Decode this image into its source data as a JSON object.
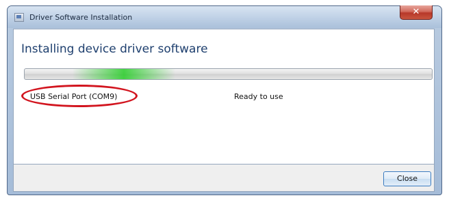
{
  "window": {
    "title": "Driver Software Installation",
    "close_glyph": "✕"
  },
  "main": {
    "heading": "Installing device driver software",
    "device": {
      "name": "USB Serial Port (COM9)",
      "status": "Ready to use"
    },
    "progress": {
      "state": "indeterminate"
    },
    "annotation": {
      "shape": "ellipse",
      "color": "#d2141e"
    }
  },
  "footer": {
    "close_label": "Close"
  },
  "colors": {
    "heading": "#1e3f6e",
    "progress_glow": "#28cd28",
    "titlebar_close": "#c8553f"
  },
  "icons": {
    "app": "window-app-icon",
    "close": "close-icon"
  }
}
